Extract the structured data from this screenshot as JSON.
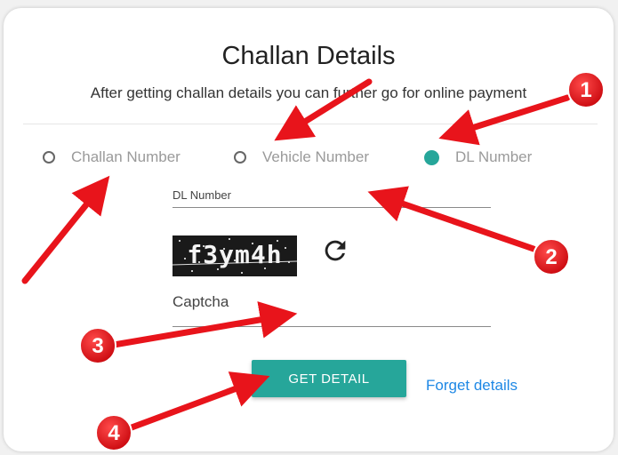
{
  "form": {
    "title": "Challan Details",
    "subtitle": "After getting challan details you can further go for online payment",
    "options": [
      {
        "label": "Challan Number",
        "checked": false
      },
      {
        "label": "Vehicle Number",
        "checked": false
      },
      {
        "label": "DL Number",
        "checked": true
      }
    ],
    "dl_field": {
      "label": "DL Number",
      "value": ""
    },
    "captcha": {
      "text": "f3ym4h"
    },
    "captcha_field": {
      "label": "Captcha",
      "value": ""
    },
    "submit_label": "GET DETAIL",
    "forgot_label": "Forget details",
    "accent_color": "#26a69a",
    "link_color": "#1e88e5"
  },
  "annotations": {
    "badges": [
      "1",
      "2",
      "3",
      "4"
    ],
    "color": "#e8141b",
    "icons": [
      "arrow-icon",
      "number-badge-icon"
    ]
  }
}
